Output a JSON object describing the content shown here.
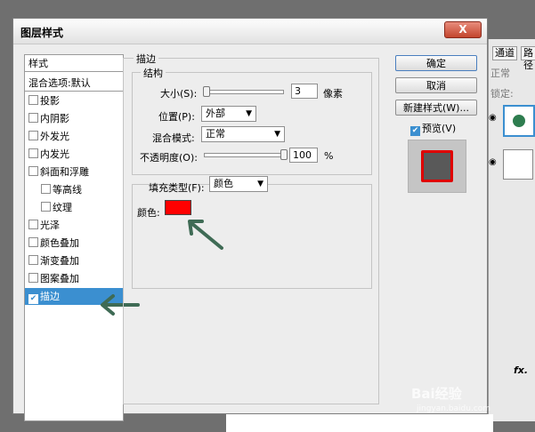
{
  "dialog": {
    "title": "图层样式",
    "close_label": "X"
  },
  "left_panel": {
    "header": "样式",
    "blend_default": "混合选项:默认",
    "items": [
      {
        "label": "投影",
        "checked": false
      },
      {
        "label": "内阴影",
        "checked": false
      },
      {
        "label": "外发光",
        "checked": false
      },
      {
        "label": "内发光",
        "checked": false
      },
      {
        "label": "斜面和浮雕",
        "checked": false
      },
      {
        "label": "等高线",
        "checked": false
      },
      {
        "label": "纹理",
        "checked": false
      },
      {
        "label": "光泽",
        "checked": false
      },
      {
        "label": "颜色叠加",
        "checked": false
      },
      {
        "label": "渐变叠加",
        "checked": false
      },
      {
        "label": "图案叠加",
        "checked": false
      },
      {
        "label": "描边",
        "checked": true
      }
    ]
  },
  "stroke": {
    "section_title": "描边",
    "structure_title": "结构",
    "size_label": "大小(S):",
    "size_value": "3",
    "size_unit": "像素",
    "position_label": "位置(P):",
    "position_value": "外部",
    "blend_label": "混合模式:",
    "blend_value": "正常",
    "opacity_label": "不透明度(O):",
    "opacity_value": "100",
    "opacity_unit": "%",
    "fill_type_label": "填充类型(F):",
    "fill_type_value": "颜色",
    "color_label": "颜色:",
    "color": "#ff0000"
  },
  "buttons": {
    "ok": "确定",
    "cancel": "取消",
    "new_style": "新建样式(W)...",
    "preview": "预览(V)",
    "preview_checked": true
  },
  "background_panel": {
    "tabs": [
      "通道",
      "路径"
    ],
    "blend_mode": "正常",
    "lock_label": "锁定:",
    "fx_label": "fx."
  },
  "watermark": {
    "brand": "Bai经验",
    "url": "jingyan.baidu.com"
  },
  "colors": {
    "selection": "#3b8fd0",
    "arrow": "#3f6b55",
    "stroke_color": "#ff0000"
  }
}
